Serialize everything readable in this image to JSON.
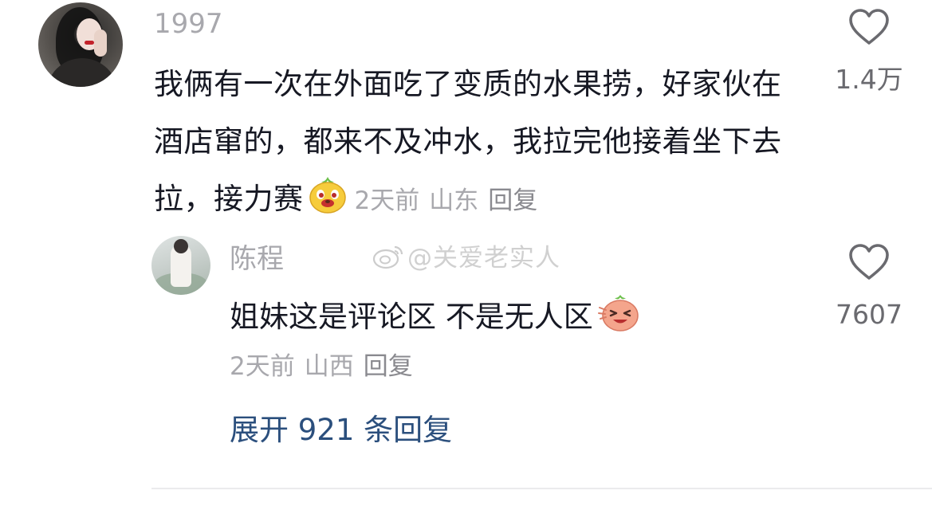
{
  "comment": {
    "username": "1997",
    "text": "我俩有一次在外面吃了变质的水果捞，好家伙在酒店窜的，都来不及冲水，我拉完他接着坐下去拉，接力赛",
    "time": "2天前",
    "location": "山东",
    "reply_label": "回复",
    "likes": "1.4万"
  },
  "reply": {
    "username": "陈程",
    "text": "姐妹这是评论区 不是无人区",
    "time": "2天前",
    "location": "山西",
    "reply_label": "回复",
    "likes": "7607"
  },
  "expand_label": "展开 921 条回复",
  "watermark": "@关爱老实人",
  "colors": {
    "text": "#161823",
    "meta": "#a8a8ad",
    "link": "#2b4f7d"
  }
}
